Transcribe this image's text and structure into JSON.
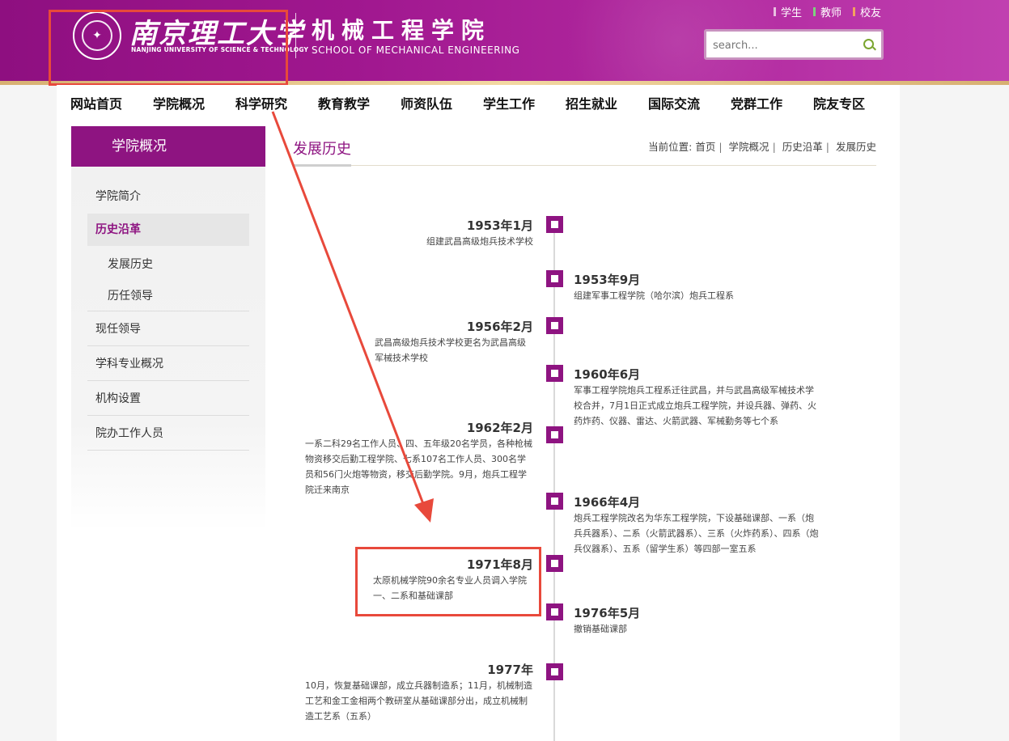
{
  "header": {
    "university_cn": "南京理工大学",
    "university_en": "NANJING UNIVERSITY OF SCIENCE & TECHNOLOGY",
    "school_cn": "机械工程学院",
    "school_en": "SCHOOL OF MECHANICAL ENGINEERING",
    "seal_icon": "university-seal-icon",
    "top_links": [
      {
        "label": "学生",
        "color": "#e8c0e0"
      },
      {
        "label": "教师",
        "color": "#7ed17e"
      },
      {
        "label": "校友",
        "color": "#f2a25e"
      }
    ],
    "search": {
      "placeholder": "search..."
    }
  },
  "nav": {
    "items": [
      "网站首页",
      "学院概况",
      "科学研究",
      "教育教学",
      "师资队伍",
      "学生工作",
      "招生就业",
      "国际交流",
      "党群工作",
      "院友专区"
    ]
  },
  "sidebar": {
    "title": "学院概况",
    "items": [
      {
        "label": "学院简介"
      },
      {
        "label": "历史沿革",
        "active": true
      },
      {
        "label": "发展历史",
        "sub": true
      },
      {
        "label": "历任领导",
        "sub": true
      },
      {
        "label": "现任领导"
      },
      {
        "label": "学科专业概况"
      },
      {
        "label": "机构设置"
      },
      {
        "label": "院办工作人员"
      }
    ]
  },
  "main": {
    "title": "发展历史",
    "breadcrumb": {
      "prefix": "当前位置:",
      "items": [
        "首页",
        "学院概况",
        "历史沿革",
        "发展历史"
      ]
    }
  },
  "timeline": [
    {
      "date": "1953年1月",
      "side": "left",
      "text": "组建武昌高级炮兵技术学校"
    },
    {
      "date": "1953年9月",
      "side": "right",
      "text": "组建军事工程学院（哈尔滨）炮兵工程系"
    },
    {
      "date": "1956年2月",
      "side": "left",
      "text": "武昌高级炮兵技术学校更名为武昌高级军械技术学校"
    },
    {
      "date": "1960年6月",
      "side": "right",
      "text": "军事工程学院炮兵工程系迁往武昌，并与武昌高级军械技术学校合并，7月1日正式成立炮兵工程学院，并设兵器、弹药、火药炸药、仪器、雷达、火箭武器、军械勤务等七个系"
    },
    {
      "date": "1962年2月",
      "side": "left",
      "text": "一系二科29名工作人员、四、五年级20名学员，各种枪械物资移交后勤工程学院、七系107名工作人员、300名学员和56门火炮等物资，移交后勤学院。9月，炮兵工程学院迁来南京"
    },
    {
      "date": "1966年4月",
      "side": "right",
      "text": "炮兵工程学院改名为华东工程学院，下设基础课部、一系（炮兵兵器系）、二系（火箭武器系）、三系（火炸药系）、四系（炮兵仪器系）、五系（留学生系）等四部一室五系"
    },
    {
      "date": "1971年8月",
      "side": "left",
      "text": "太原机械学院90余名专业人员调入学院一、二系和基础课部",
      "highlighted": true
    },
    {
      "date": "1976年5月",
      "side": "right",
      "text": "撤销基础课部"
    },
    {
      "date": "1977年",
      "side": "left",
      "text": "10月，恢复基础课部，成立兵器制造系；11月，机械制造工艺和金工金相两个教研室从基础课部分出，成立机械制造工艺系（五系）"
    }
  ],
  "colors": {
    "brand_purple": "#8e1481",
    "annotation_red": "#e8493b",
    "header_gold": "#e8c891"
  }
}
